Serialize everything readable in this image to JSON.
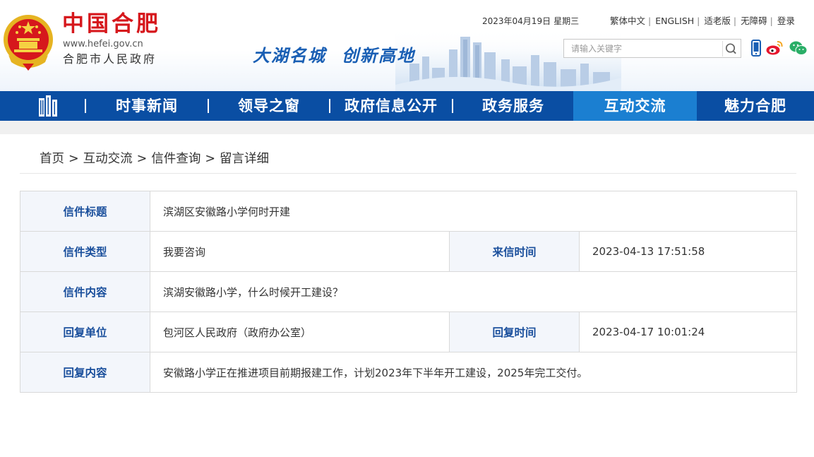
{
  "header": {
    "logo_title": "中国合肥",
    "logo_url": "www.hefei.gov.cn",
    "logo_subtitle": "合肥市人民政府",
    "slogan_part1": "大湖名城",
    "slogan_part2": "创新高地",
    "date": "2023年04月19日",
    "weekday": "星期三",
    "links": [
      "繁体中文",
      "ENGLISH",
      "适老版",
      "无障碍",
      "登录"
    ],
    "search_placeholder": "请输入关键字",
    "icons": [
      "search-icon",
      "mobile-icon",
      "weibo-icon",
      "wechat-icon"
    ]
  },
  "nav": {
    "items": [
      "时事新闻",
      "领导之窗",
      "政府信息公开",
      "政务服务",
      "互动交流",
      "魅力合肥"
    ],
    "active": "互动交流",
    "colors": {
      "bar": "#0a4ea3",
      "active": "#1b7fd1"
    }
  },
  "breadcrumb": [
    "首页",
    "互动交流",
    "信件查询",
    "留言详细"
  ],
  "breadcrumb_separator": ">",
  "letter": {
    "title_label": "信件标题",
    "title": "滨湖区安徽路小学何时开建",
    "type_label": "信件类型",
    "type": "我要咨询",
    "sent_time_label": "来信时间",
    "sent_time": "2023-04-13 17:51:58",
    "content_label": "信件内容",
    "content": "滨湖安徽路小学，什么时候开工建设？",
    "reply_unit_label": "回复单位",
    "reply_unit": "包河区人民政府（政府办公室）",
    "reply_time_label": "回复时间",
    "reply_time": "2023-04-17 10:01:24",
    "reply_content_label": "回复内容",
    "reply_content": "安徽路小学正在推进项目前期报建工作，计划2023年下半年开工建设，2025年完工交付。"
  }
}
